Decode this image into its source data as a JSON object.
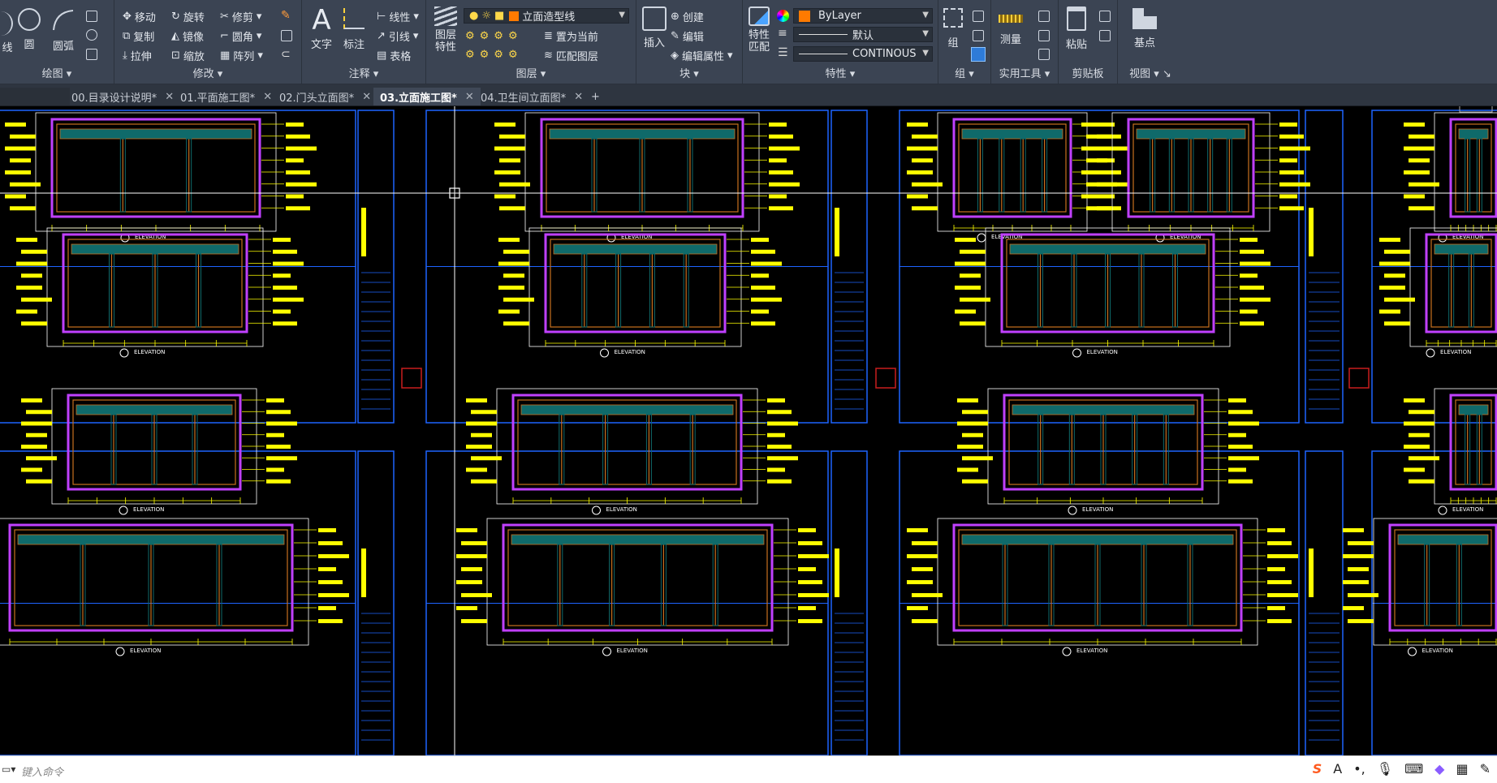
{
  "ribbon": {
    "draw": {
      "line_frag": "线",
      "circle": "圆",
      "arc": "圆弧",
      "title": "绘图"
    },
    "modify": {
      "move": "移动",
      "rotate": "旋转",
      "trim": "修剪",
      "copy": "复制",
      "mirror": "镜像",
      "fillet": "圆角",
      "stretch": "拉伸",
      "scale": "缩放",
      "array": "阵列",
      "title": "修改"
    },
    "annotation": {
      "text": "文字",
      "dimension": "标注",
      "linear": "线性",
      "leader": "引线",
      "table": "表格",
      "title": "注释"
    },
    "layers": {
      "layer_props_1": "图层",
      "layer_props_2": "特性",
      "current_layer": "立面造型线",
      "make_current": "置为当前",
      "match_layer": "匹配图层",
      "title": "图层"
    },
    "block": {
      "insert": "插入",
      "create": "创建",
      "edit": "编辑",
      "edit_attr": "编辑属性",
      "title": "块"
    },
    "properties": {
      "match_1": "特性",
      "match_2": "匹配",
      "color": "ByLayer",
      "lineweight": "默认",
      "linetype": "CONTINOUS",
      "title": "特性"
    },
    "groups": {
      "group": "组",
      "title": "组"
    },
    "utilities": {
      "measure": "测量",
      "title": "实用工具"
    },
    "clipboard": {
      "paste": "粘贴",
      "title": "剪贴板"
    },
    "view": {
      "base": "基点",
      "title": "视图"
    }
  },
  "colors": {
    "accent_orange": "#ff7a00",
    "cad_yellow": "#ffff00",
    "cad_blue": "#1e64ff",
    "cad_magenta": "#c040ff",
    "cad_orange_line": "#c8701e",
    "cad_teal": "#0f6a6a"
  },
  "tabs": [
    {
      "label": "00.目录设计说明*",
      "active": false
    },
    {
      "label": "01.平面施工图*",
      "active": false
    },
    {
      "label": "02.门头立面图*",
      "active": false
    },
    {
      "label": "03.立面施工图*",
      "active": true
    },
    {
      "label": "04.卫生间立面图*",
      "active": false
    }
  ],
  "tab_close": "✕",
  "tab_add": "+",
  "elevation_label": "ELEVATION",
  "command_line": {
    "placeholder": "键入命令"
  },
  "tray": {
    "icons": [
      "sogou-icon",
      "text-mode-icon",
      "punctuation-icon",
      "microphone-icon",
      "keyboard-icon",
      "skin-icon",
      "apps-icon",
      "tools-icon"
    ]
  }
}
